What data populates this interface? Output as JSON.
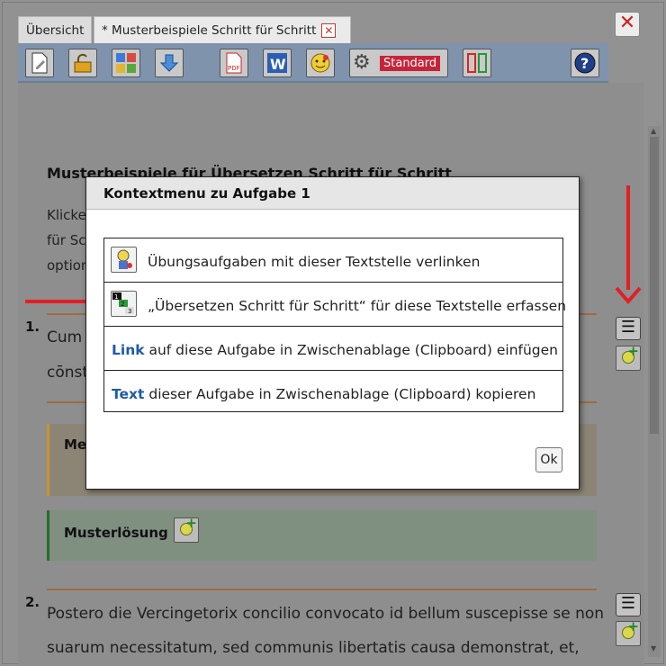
{
  "tabs": [
    {
      "label": "Übersicht"
    },
    {
      "label": "* Musterbeispiele Schritt für Schritt"
    }
  ],
  "toolbar": {
    "standard_label": "Standard"
  },
  "document": {
    "title": "Musterbeispiele für Übersetzen Schritt für Schritt",
    "intro_lines": [
      "Klicke",
      "für Sc",
      "option"
    ],
    "exercises": [
      {
        "number": "1.",
        "lines": [
          "Cum",
          "cōnst"
        ]
      },
      {
        "number": "2.",
        "lines": [
          "Postero die Vercingetorix concilio convocato id bellum suscepisse se non",
          "suarum necessitatum, sed communis libertatis causa demonstrat, et,"
        ]
      }
    ],
    "box_orange_label": "Me",
    "solution_label": "Musterlösung"
  },
  "modal": {
    "title": "Kontextmenu zu Aufgabe 1",
    "items": [
      {
        "keyword": "",
        "text": "Übungsaufgaben mit dieser Textstelle verlinken",
        "icon": "exercise-link-icon"
      },
      {
        "keyword": "",
        "text": "„Übersetzen Schritt für Schritt“ für diese Textstelle erfassen",
        "icon": "steps-123-icon"
      },
      {
        "keyword": "Link",
        "text": " auf diese Aufgabe in Zwischenablage (Clipboard) einfügen",
        "icon": ""
      },
      {
        "keyword": "Text",
        "text": " dieser Aufgabe in Zwischenablage (Clipboard) kopieren",
        "icon": ""
      }
    ],
    "ok_label": "Ok"
  },
  "colors": {
    "accent_red": "#e41e24",
    "link_blue": "#1d5bab",
    "toolbar": "#7f93ad"
  }
}
